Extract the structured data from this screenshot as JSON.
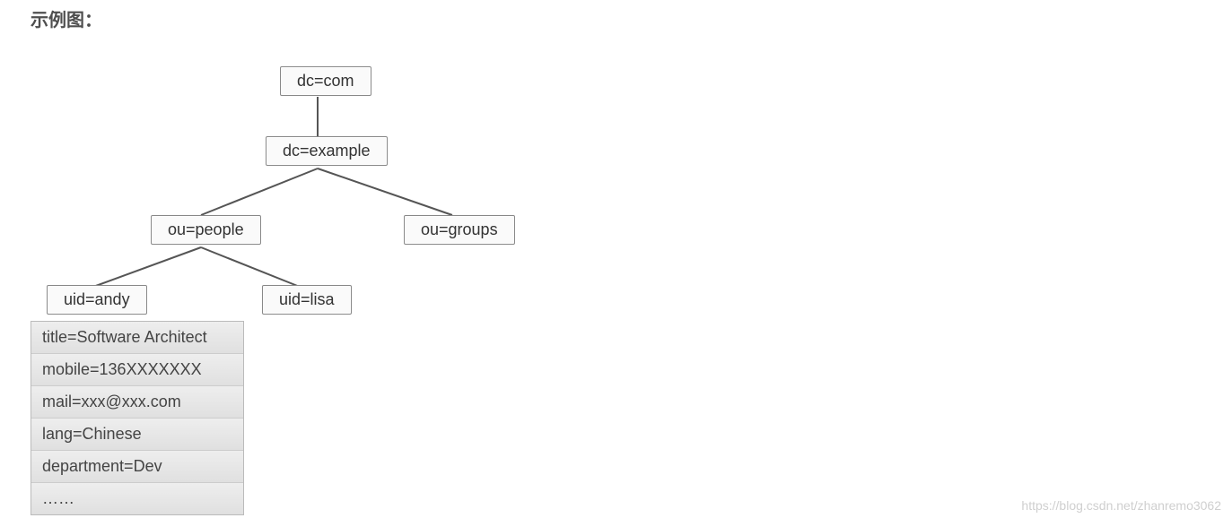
{
  "heading": "示例图：",
  "tree": {
    "root": {
      "label": "dc=com"
    },
    "level1": {
      "label": "dc=example"
    },
    "level2a": {
      "label": "ou=people"
    },
    "level2b": {
      "label": "ou=groups"
    },
    "level3a": {
      "label": "uid=andy"
    },
    "level3b": {
      "label": "uid=lisa"
    }
  },
  "attributes": [
    "title=Software Architect",
    "mobile=136XXXXXXX",
    "mail=xxx@xxx.com",
    "lang=Chinese",
    "department=Dev",
    "……"
  ],
  "watermark": "https://blog.csdn.net/zhanremo3062"
}
